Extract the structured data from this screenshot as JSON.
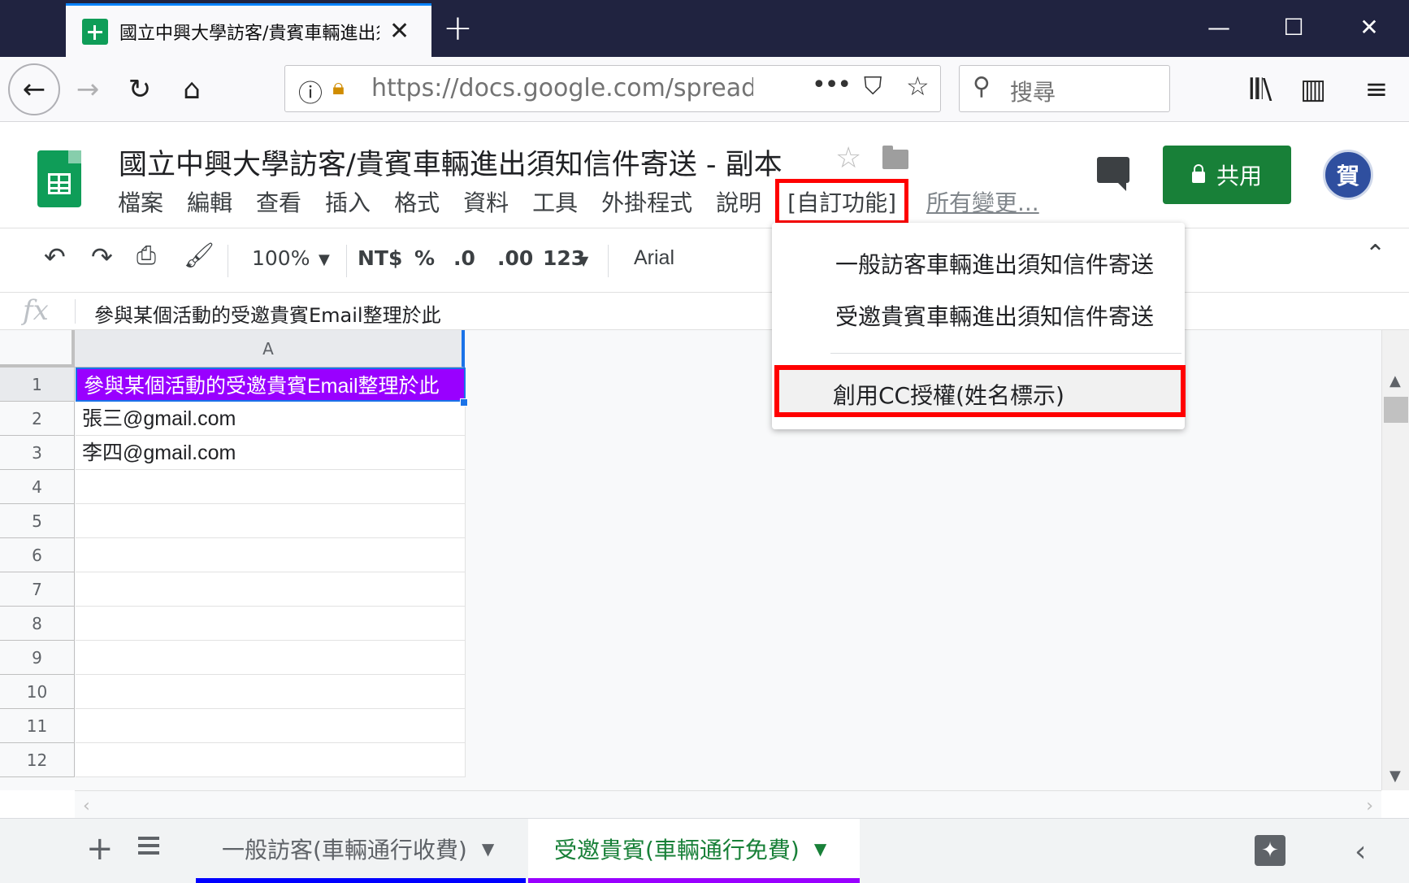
{
  "browser": {
    "tab_title": "國立中興大學訪客/貴賓車輛進出須知信件寄送",
    "url": "https://docs.google.com/spreadsheets",
    "search_placeholder": "搜尋"
  },
  "sheets": {
    "doc_title": "國立中興大學訪客/貴賓車輛進出須知信件寄送 - 副本",
    "share_label": "共用",
    "avatar_text": "賀",
    "menu": [
      "檔案",
      "編輯",
      "查看",
      "插入",
      "格式",
      "資料",
      "工具",
      "外掛程式",
      "說明"
    ],
    "menu_custom": "[自訂功能]",
    "menu_changes": "所有變更...",
    "toolbar": {
      "zoom": "100%",
      "currency": "NT$",
      "percent": "%",
      "dec_decrease": ".0",
      "dec_increase": ".00",
      "number_format": "123",
      "font": "Arial"
    },
    "formula_value": "參與某個活動的受邀貴賓Email整理於此",
    "column_header": "A",
    "rows": [
      {
        "n": "1",
        "value": "參與某個活動的受邀貴賓Email整理於此"
      },
      {
        "n": "2",
        "value": "張三@gmail.com"
      },
      {
        "n": "3",
        "value": "李四@gmail.com"
      },
      {
        "n": "4",
        "value": ""
      },
      {
        "n": "5",
        "value": ""
      },
      {
        "n": "6",
        "value": ""
      },
      {
        "n": "7",
        "value": ""
      },
      {
        "n": "8",
        "value": ""
      },
      {
        "n": "9",
        "value": ""
      },
      {
        "n": "10",
        "value": ""
      },
      {
        "n": "11",
        "value": ""
      },
      {
        "n": "12",
        "value": ""
      }
    ],
    "dropdown": {
      "item1": "一般訪客車輛進出須知信件寄送",
      "item2": "受邀貴賓車輛進出須知信件寄送",
      "item3": "創用CC授權(姓名標示)"
    },
    "sheet_tabs": [
      {
        "label": "一般訪客(車輛通行收費)",
        "color": "#0000ff"
      },
      {
        "label": "受邀貴賓(車輛通行免費)",
        "color": "#9900ff"
      }
    ]
  },
  "colors": {
    "accent_green": "#188038",
    "highlight_red": "#ff0000",
    "selected_cell": "#9900ff"
  }
}
